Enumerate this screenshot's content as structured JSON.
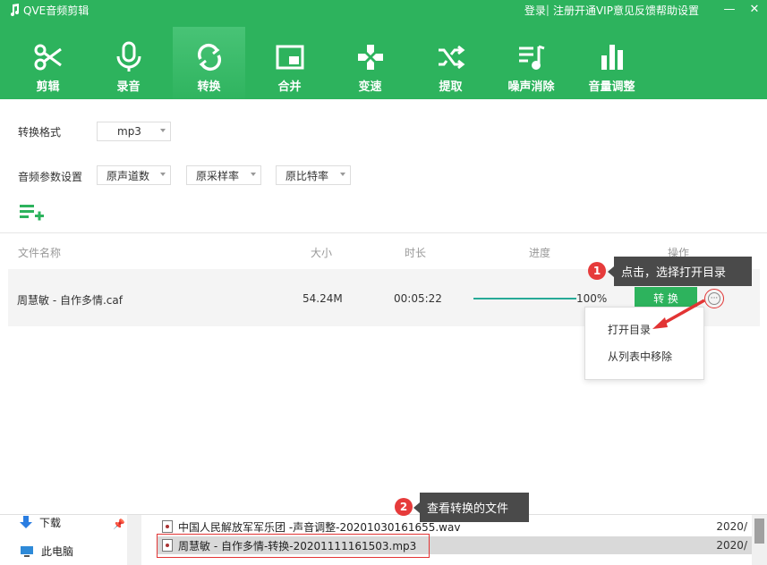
{
  "app": {
    "title": "QVE音频剪辑"
  },
  "menu": {
    "login": "登录",
    "sep": "|",
    "register": "注册",
    "vip": "开通VIP",
    "feedback": "意见反馈",
    "help": "帮助",
    "settings": "设置",
    "minimize": "—",
    "close": "✕"
  },
  "tabs": [
    {
      "label": "剪辑",
      "icon": "scissors-icon"
    },
    {
      "label": "录音",
      "icon": "microphone-icon"
    },
    {
      "label": "转换",
      "icon": "refresh-icon",
      "active": true
    },
    {
      "label": "合并",
      "icon": "merge-icon"
    },
    {
      "label": "变速",
      "icon": "gamepad-icon"
    },
    {
      "label": "提取",
      "icon": "shuffle-icon"
    },
    {
      "label": "噪声消除",
      "icon": "noise-icon"
    },
    {
      "label": "音量调整",
      "icon": "volume-bars-icon"
    }
  ],
  "settings": {
    "format_label": "转换格式",
    "format_value": "mp3",
    "params_label": "音频参数设置",
    "channels_value": "原声道数",
    "samplerate_value": "原采样率",
    "bitrate_value": "原比特率"
  },
  "table": {
    "headers": {
      "name": "文件名称",
      "size": "大小",
      "duration": "时长",
      "progress": "进度",
      "action": "操作"
    },
    "row": {
      "name": "周慧敏 - 自作多情.caf",
      "size": "54.24M",
      "duration": "00:05:22",
      "progress_percent": 100,
      "progress_text": "100%",
      "convert_label": "转 换",
      "more_label": "···"
    }
  },
  "dropdown": {
    "open_dir": "打开目录",
    "remove": "从列表中移除"
  },
  "tips": [
    {
      "num": "1",
      "text": "点击，选择打开目录"
    },
    {
      "num": "2",
      "text": "查看转换的文件"
    }
  ],
  "explorer": {
    "nav": [
      {
        "label": "下载",
        "icon": "download-arrow-icon"
      },
      {
        "label": "此电脑",
        "icon": "computer-icon"
      }
    ],
    "files": [
      {
        "name": "中国人民解放军军乐团 -声音调整-20201030161655.wav",
        "date": "2020/"
      },
      {
        "name": "周慧敏 - 自作多情-转换-20201111161503.mp3",
        "date": "2020/"
      }
    ]
  },
  "colors": {
    "brand": "#2db35d",
    "progress": "#27a997",
    "highlight": "#e23434",
    "tooltip": "#4a4a4a"
  }
}
